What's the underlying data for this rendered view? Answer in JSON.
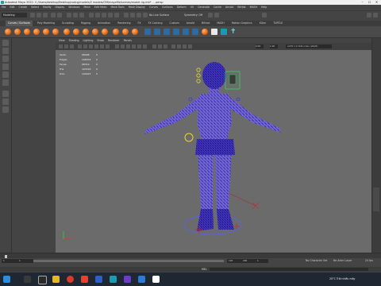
{
  "window": {
    "title": "Autodesk Maya 2022: C:/Users/desktop/Desktop/cadcg/models/2 models/OM/mayafile/scenes/model-rig.mb* - - persp",
    "controls": [
      "–",
      "☐",
      "✕"
    ]
  },
  "menubar": [
    "File",
    "Edit",
    "Create",
    "Select",
    "Modify",
    "Display",
    "Windows",
    "Mesh",
    "Edit Mesh",
    "Mesh Tools",
    "Mesh Display",
    "Curves",
    "Surfaces",
    "Deform",
    "UV",
    "Generate",
    "Cache",
    "Arnold",
    "Bifröst",
    "MASH",
    "Help"
  ],
  "statusline": {
    "mode": "Modeling",
    "live_surface": "No Live Surface",
    "symmetry": "Symmetry: Off"
  },
  "shelf_tabs": [
    "Curves / Surfaces",
    "Poly Modeling",
    "Sculpting",
    "Rigging",
    "Animation",
    "Rendering",
    "FX",
    "FX Caching",
    "Custom",
    "Arnold",
    "Bifrost",
    "MASH",
    "Motion Graphics",
    "XGen",
    "TURTLE"
  ],
  "active_shelf_tab": "Curves / Surfaces",
  "panel_menu": [
    "View",
    "Shading",
    "Lighting",
    "Show",
    "Renderer",
    "Panels"
  ],
  "camera_field": {
    "value1": "0.00",
    "value2": "1.00",
    "color_space": "ACES 1.0 SDR-video (sRGB)"
  },
  "hud_stats": [
    {
      "label": "Verts:",
      "value": "98998",
      "count": "0"
    },
    {
      "label": "Edges:",
      "value": "196533",
      "count": "0"
    },
    {
      "label": "Faces:",
      "value": "98319",
      "count": "0"
    },
    {
      "label": "Tris:",
      "value": "194316",
      "count": "0"
    },
    {
      "label": "UVs:",
      "value": "109423",
      "count": "0"
    }
  ],
  "range": {
    "start": "1",
    "start_inner": "1",
    "end_inner": "120",
    "end": "200",
    "current": "1",
    "character_set": "No Character Set",
    "anim_layer": "No Anim Layer",
    "fps": "24 fps"
  },
  "command_line_label": "MEL",
  "taskbar": {
    "temperature": "20°C",
    "condition": "Trời nhiều mây"
  },
  "colors": {
    "viewport_bg": "#6b6b6b",
    "wireframe": "#3d2fb8",
    "skin": "#8a7ad8",
    "accent": "#1a9bb0"
  }
}
